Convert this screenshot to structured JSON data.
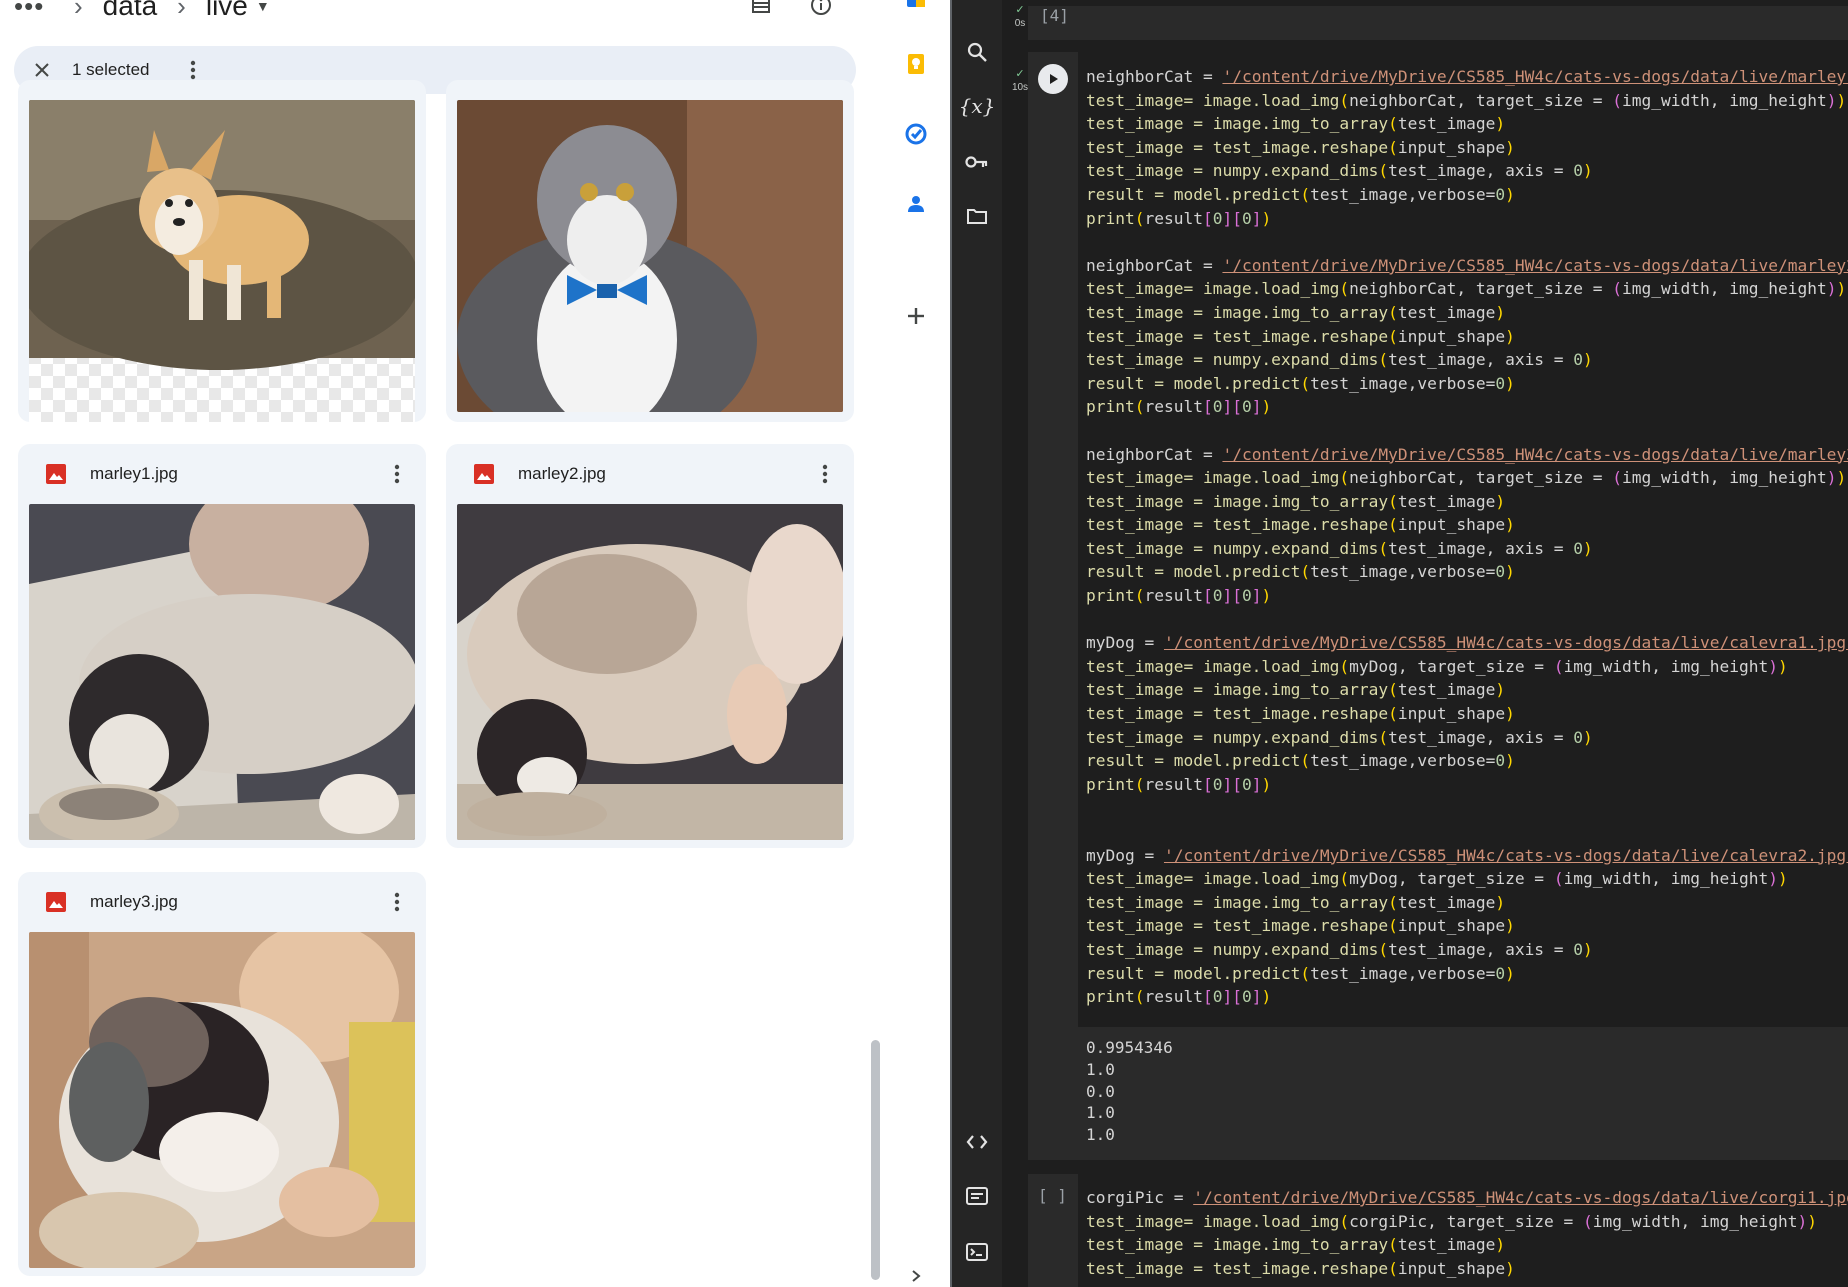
{
  "drive": {
    "breadcrumb": {
      "more": "•••",
      "folder": "data",
      "subfolder": "live"
    },
    "selection": {
      "label": "1 selected"
    },
    "files": [
      {
        "name": "marley1.jpg"
      },
      {
        "name": "marley2.jpg"
      },
      {
        "name": "marley3.jpg"
      }
    ]
  },
  "colab": {
    "cell_prev": {
      "exec_count": "[4]",
      "time": "0s"
    },
    "cell_main": {
      "time": "10s",
      "lines": [
        [
          [
            "neighborCat = ",
            ""
          ],
          [
            "'/content/drive/MyDrive/CS585_HW4c/cats-vs-dogs/data/live/marley1",
            "str"
          ]
        ],
        [
          [
            "test_image= image.load_img",
            "kwfn"
          ],
          [
            "(",
            "paren"
          ],
          [
            "neighborCat, target_size = ",
            ""
          ],
          [
            "(",
            "paren2"
          ],
          [
            "img_width, img_height",
            ""
          ],
          [
            ")",
            "paren2"
          ],
          [
            ")",
            "paren"
          ]
        ],
        [
          [
            "test_image = image.img_to_array",
            "kwfn"
          ],
          [
            "(",
            "paren"
          ],
          [
            "test_image",
            ""
          ],
          [
            ")",
            "paren"
          ]
        ],
        [
          [
            "test_image = test_image.reshape",
            "kwfn"
          ],
          [
            "(",
            "paren"
          ],
          [
            "input_shape",
            ""
          ],
          [
            ")",
            "paren"
          ]
        ],
        [
          [
            "test_image = numpy.expand_dims",
            "kwfn"
          ],
          [
            "(",
            "paren"
          ],
          [
            "test_image, axis = ",
            ""
          ],
          [
            "0",
            "num"
          ],
          [
            ")",
            "paren"
          ]
        ],
        [
          [
            "result = model.predict",
            "kwfn"
          ],
          [
            "(",
            "paren"
          ],
          [
            "test_image,verbose=",
            ""
          ],
          [
            "0",
            "num"
          ],
          [
            ")",
            "paren"
          ]
        ],
        [
          [
            "print",
            "kwfn"
          ],
          [
            "(",
            "paren"
          ],
          [
            "result",
            ""
          ],
          [
            "[",
            "paren2"
          ],
          [
            "0",
            "num"
          ],
          [
            "]",
            "paren2"
          ],
          [
            "[",
            "paren2"
          ],
          [
            "0",
            "num"
          ],
          [
            "]",
            "paren2"
          ],
          [
            ")",
            "paren"
          ]
        ],
        [
          [
            "",
            ""
          ]
        ],
        [
          [
            "neighborCat = ",
            ""
          ],
          [
            "'/content/drive/MyDrive/CS585_HW4c/cats-vs-dogs/data/live/marley2",
            "str"
          ]
        ],
        [
          [
            "test_image= image.load_img",
            "kwfn"
          ],
          [
            "(",
            "paren"
          ],
          [
            "neighborCat, target_size = ",
            ""
          ],
          [
            "(",
            "paren2"
          ],
          [
            "img_width, img_height",
            ""
          ],
          [
            ")",
            "paren2"
          ],
          [
            ")",
            "paren"
          ]
        ],
        [
          [
            "test_image = image.img_to_array",
            "kwfn"
          ],
          [
            "(",
            "paren"
          ],
          [
            "test_image",
            ""
          ],
          [
            ")",
            "paren"
          ]
        ],
        [
          [
            "test_image = test_image.reshape",
            "kwfn"
          ],
          [
            "(",
            "paren"
          ],
          [
            "input_shape",
            ""
          ],
          [
            ")",
            "paren"
          ]
        ],
        [
          [
            "test_image = numpy.expand_dims",
            "kwfn"
          ],
          [
            "(",
            "paren"
          ],
          [
            "test_image, axis = ",
            ""
          ],
          [
            "0",
            "num"
          ],
          [
            ")",
            "paren"
          ]
        ],
        [
          [
            "result = model.predict",
            "kwfn"
          ],
          [
            "(",
            "paren"
          ],
          [
            "test_image,verbose=",
            ""
          ],
          [
            "0",
            "num"
          ],
          [
            ")",
            "paren"
          ]
        ],
        [
          [
            "print",
            "kwfn"
          ],
          [
            "(",
            "paren"
          ],
          [
            "result",
            ""
          ],
          [
            "[",
            "paren2"
          ],
          [
            "0",
            "num"
          ],
          [
            "]",
            "paren2"
          ],
          [
            "[",
            "paren2"
          ],
          [
            "0",
            "num"
          ],
          [
            "]",
            "paren2"
          ],
          [
            ")",
            "paren"
          ]
        ],
        [
          [
            "",
            ""
          ]
        ],
        [
          [
            "neighborCat = ",
            ""
          ],
          [
            "'/content/drive/MyDrive/CS585_HW4c/cats-vs-dogs/data/live/marley3",
            "str"
          ]
        ],
        [
          [
            "test_image= image.load_img",
            "kwfn"
          ],
          [
            "(",
            "paren"
          ],
          [
            "neighborCat, target_size = ",
            ""
          ],
          [
            "(",
            "paren2"
          ],
          [
            "img_width, img_height",
            ""
          ],
          [
            ")",
            "paren2"
          ],
          [
            ")",
            "paren"
          ]
        ],
        [
          [
            "test_image = image.img_to_array",
            "kwfn"
          ],
          [
            "(",
            "paren"
          ],
          [
            "test_image",
            ""
          ],
          [
            ")",
            "paren"
          ]
        ],
        [
          [
            "test_image = test_image.reshape",
            "kwfn"
          ],
          [
            "(",
            "paren"
          ],
          [
            "input_shape",
            ""
          ],
          [
            ")",
            "paren"
          ]
        ],
        [
          [
            "test_image = numpy.expand_dims",
            "kwfn"
          ],
          [
            "(",
            "paren"
          ],
          [
            "test_image, axis = ",
            ""
          ],
          [
            "0",
            "num"
          ],
          [
            ")",
            "paren"
          ]
        ],
        [
          [
            "result = model.predict",
            "kwfn"
          ],
          [
            "(",
            "paren"
          ],
          [
            "test_image,verbose=",
            ""
          ],
          [
            "0",
            "num"
          ],
          [
            ")",
            "paren"
          ]
        ],
        [
          [
            "print",
            "kwfn"
          ],
          [
            "(",
            "paren"
          ],
          [
            "result",
            ""
          ],
          [
            "[",
            "paren2"
          ],
          [
            "0",
            "num"
          ],
          [
            "]",
            "paren2"
          ],
          [
            "[",
            "paren2"
          ],
          [
            "0",
            "num"
          ],
          [
            "]",
            "paren2"
          ],
          [
            ")",
            "paren"
          ]
        ],
        [
          [
            "",
            ""
          ]
        ],
        [
          [
            "myDog = ",
            ""
          ],
          [
            "'/content/drive/MyDrive/CS585_HW4c/cats-vs-dogs/data/live/calevra1.jpg'",
            "str"
          ]
        ],
        [
          [
            "test_image= image.load_img",
            "kwfn"
          ],
          [
            "(",
            "paren"
          ],
          [
            "myDog, target_size = ",
            ""
          ],
          [
            "(",
            "paren2"
          ],
          [
            "img_width, img_height",
            ""
          ],
          [
            ")",
            "paren2"
          ],
          [
            ")",
            "paren"
          ]
        ],
        [
          [
            "test_image = image.img_to_array",
            "kwfn"
          ],
          [
            "(",
            "paren"
          ],
          [
            "test_image",
            ""
          ],
          [
            ")",
            "paren"
          ]
        ],
        [
          [
            "test_image = test_image.reshape",
            "kwfn"
          ],
          [
            "(",
            "paren"
          ],
          [
            "input_shape",
            ""
          ],
          [
            ")",
            "paren"
          ]
        ],
        [
          [
            "test_image = numpy.expand_dims",
            "kwfn"
          ],
          [
            "(",
            "paren"
          ],
          [
            "test_image, axis = ",
            ""
          ],
          [
            "0",
            "num"
          ],
          [
            ")",
            "paren"
          ]
        ],
        [
          [
            "result = model.predict",
            "kwfn"
          ],
          [
            "(",
            "paren"
          ],
          [
            "test_image,verbose=",
            ""
          ],
          [
            "0",
            "num"
          ],
          [
            ")",
            "paren"
          ]
        ],
        [
          [
            "print",
            "kwfn"
          ],
          [
            "(",
            "paren"
          ],
          [
            "result",
            ""
          ],
          [
            "[",
            "paren2"
          ],
          [
            "0",
            "num"
          ],
          [
            "]",
            "paren2"
          ],
          [
            "[",
            "paren2"
          ],
          [
            "0",
            "num"
          ],
          [
            "]",
            "paren2"
          ],
          [
            ")",
            "paren"
          ]
        ],
        [
          [
            "",
            ""
          ]
        ],
        [
          [
            "",
            ""
          ]
        ],
        [
          [
            "myDog = ",
            ""
          ],
          [
            "'/content/drive/MyDrive/CS585_HW4c/cats-vs-dogs/data/live/calevra2.jpg'",
            "str"
          ]
        ],
        [
          [
            "test_image= image.load_img",
            "kwfn"
          ],
          [
            "(",
            "paren"
          ],
          [
            "myDog, target_size = ",
            ""
          ],
          [
            "(",
            "paren2"
          ],
          [
            "img_width, img_height",
            ""
          ],
          [
            ")",
            "paren2"
          ],
          [
            ")",
            "paren"
          ]
        ],
        [
          [
            "test_image = image.img_to_array",
            "kwfn"
          ],
          [
            "(",
            "paren"
          ],
          [
            "test_image",
            ""
          ],
          [
            ")",
            "paren"
          ]
        ],
        [
          [
            "test_image = test_image.reshape",
            "kwfn"
          ],
          [
            "(",
            "paren"
          ],
          [
            "input_shape",
            ""
          ],
          [
            ")",
            "paren"
          ]
        ],
        [
          [
            "test_image = numpy.expand_dims",
            "kwfn"
          ],
          [
            "(",
            "paren"
          ],
          [
            "test_image, axis = ",
            ""
          ],
          [
            "0",
            "num"
          ],
          [
            ")",
            "paren"
          ]
        ],
        [
          [
            "result = model.predict",
            "kwfn"
          ],
          [
            "(",
            "paren"
          ],
          [
            "test_image,verbose=",
            ""
          ],
          [
            "0",
            "num"
          ],
          [
            ")",
            "paren"
          ]
        ],
        [
          [
            "print",
            "kwfn"
          ],
          [
            "(",
            "paren"
          ],
          [
            "result",
            ""
          ],
          [
            "[",
            "paren2"
          ],
          [
            "0",
            "num"
          ],
          [
            "]",
            "paren2"
          ],
          [
            "[",
            "paren2"
          ],
          [
            "0",
            "num"
          ],
          [
            "]",
            "paren2"
          ],
          [
            ")",
            "paren"
          ]
        ]
      ],
      "output": [
        "0.9954346",
        "1.0",
        "0.0",
        "1.0",
        "1.0"
      ]
    },
    "cell_next": {
      "exec_count": "[ ]",
      "lines": [
        [
          [
            "corgiPic = ",
            ""
          ],
          [
            "'/content/drive/MyDrive/CS585_HW4c/cats-vs-dogs/data/live/corgi1.jpg",
            "str"
          ]
        ],
        [
          [
            "test_image= image.load_img",
            "kwfn"
          ],
          [
            "(",
            "paren"
          ],
          [
            "corgiPic, target_size = ",
            ""
          ],
          [
            "(",
            "paren2"
          ],
          [
            "img_width, img_height",
            ""
          ],
          [
            ")",
            "paren2"
          ],
          [
            ")",
            "paren"
          ]
        ],
        [
          [
            "test_image = image.img_to_array",
            "kwfn"
          ],
          [
            "(",
            "paren"
          ],
          [
            "test_image",
            ""
          ],
          [
            ")",
            "paren"
          ]
        ],
        [
          [
            "test_image = test_image.reshape",
            "kwfn"
          ],
          [
            "(",
            "paren"
          ],
          [
            "input_shape",
            ""
          ],
          [
            ")",
            "paren"
          ]
        ]
      ]
    }
  },
  "colors": {
    "colab_bg": "#1e1e1e",
    "drive_card": "#f0f4f9",
    "selection_bar": "#e9eef6",
    "file_icon": "#d93025"
  }
}
